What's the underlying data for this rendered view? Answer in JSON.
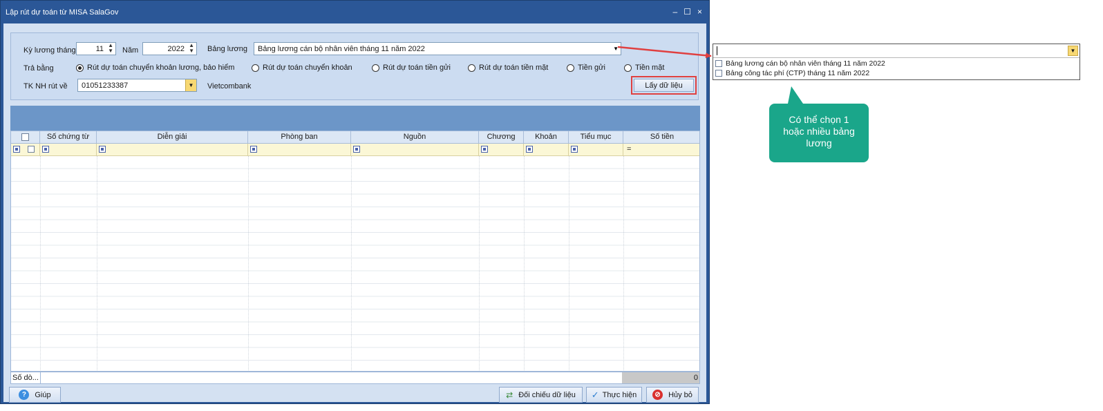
{
  "window": {
    "title": "Lập rút dự toán từ MISA SalaGov",
    "controls": {
      "minimize": "–",
      "maximize": "☐",
      "close": "×"
    }
  },
  "params": {
    "ky_luong_label": "Kỳ lương tháng",
    "month_value": "11",
    "nam_label": "Năm",
    "year_value": "2022",
    "bang_luong_label": "Bảng lương",
    "bang_luong_value": "Bảng lương cán bộ nhân viên tháng 11 năm 2022",
    "tra_bang_label": "Trả bằng",
    "payment_options": [
      {
        "label": "Rút dự toán chuyển khoản lương, bảo hiểm",
        "selected": true
      },
      {
        "label": "Rút dự toán chuyển khoản",
        "selected": false
      },
      {
        "label": "Rút dự toán tiền gửi",
        "selected": false
      },
      {
        "label": "Rút dự toán tiền mặt",
        "selected": false
      },
      {
        "label": "Tiền gửi",
        "selected": false
      },
      {
        "label": "Tiền mặt",
        "selected": false
      }
    ],
    "tk_nh_label": "TK NH rút về",
    "tk_nh_value": "01051233387",
    "bank_name": "Vietcombank",
    "get_data_button": "Lấy dữ liệu"
  },
  "grid": {
    "columns": [
      "",
      "Số chứng từ",
      "Diễn giải",
      "Phòng ban",
      "Nguồn",
      "Chương",
      "Khoản",
      "Tiểu mục",
      "Số tiền"
    ],
    "filter_equals": "=",
    "footer_label": "Số dò...",
    "footer_total": "0"
  },
  "buttons": {
    "help": "Giúp",
    "compare": "Đối chiếu dữ liệu",
    "execute": "Thực hiện",
    "cancel": "Hủy bỏ"
  },
  "dropdown": {
    "items": [
      "Bảng lương cán bộ nhân viên tháng 11 năm 2022",
      "Bảng công tác phí (CTP) tháng 11 năm 2022"
    ]
  },
  "callout": {
    "text": "Có thể chọn 1 hoặc nhiều bảng lương"
  },
  "colors": {
    "title_bar": "#2b5797",
    "grid_band": "#6c96c8",
    "highlight_red": "#e04040",
    "callout": "#1aa68a",
    "dropdown_arrow": "#f7d873"
  }
}
